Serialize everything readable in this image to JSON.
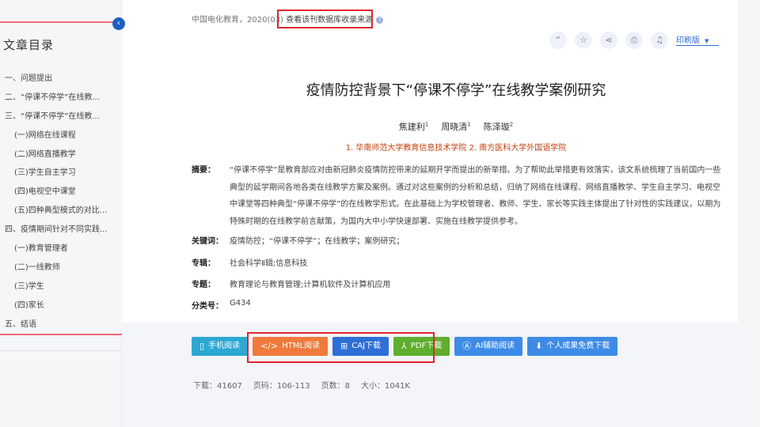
{
  "sidebar": {
    "title": "文章目录",
    "collapse_glyph": "‹",
    "items": [
      {
        "label": "一、问题提出",
        "sub": false
      },
      {
        "label": "二、“停课不停学”在线教...",
        "sub": false
      },
      {
        "label": "三、“停课不停学”在线教...",
        "sub": false
      },
      {
        "label": "(一)网络在线课程",
        "sub": true
      },
      {
        "label": "(二)网络直播教学",
        "sub": true
      },
      {
        "label": "(三)学生自主学习",
        "sub": true
      },
      {
        "label": "(四)电视空中课堂",
        "sub": true
      },
      {
        "label": "(五)四种典型模式的对比...",
        "sub": true
      },
      {
        "label": "四、疫情期间针对不同实践...",
        "sub": false
      },
      {
        "label": "(一)教育管理者",
        "sub": true
      },
      {
        "label": "(二)一线教师",
        "sub": true
      },
      {
        "label": "(三)学生",
        "sub": true
      },
      {
        "label": "(四)家长",
        "sub": true
      },
      {
        "label": "五、结语",
        "sub": false
      }
    ]
  },
  "source": {
    "journal": "中国电化教育，2020(03)",
    "link": "查看该刊数据库收录来源",
    "info_glyph": "?"
  },
  "tools": {
    "icons": [
      {
        "name": "quote-icon",
        "glyph": "“"
      },
      {
        "name": "favorite-icon",
        "glyph": "☆"
      },
      {
        "name": "share-icon",
        "glyph": "⋖"
      },
      {
        "name": "print-icon",
        "glyph": "⎙"
      },
      {
        "name": "bell-icon",
        "glyph": "♫"
      }
    ],
    "print_label": "印刷版",
    "print_arrow": "▼"
  },
  "article": {
    "title": "疫情防控背景下“停课不停学”在线教学案例研究",
    "authors": [
      {
        "name": "焦建利",
        "sup": "1"
      },
      {
        "name": "周晓清",
        "sup": "1"
      },
      {
        "name": "陈泽璇",
        "sup": "2"
      }
    ],
    "affiliations": "1. 华南师范大学教育信息技术学院  2. 南方医科大学外国语学院",
    "abstract_label": "摘要：",
    "abstract": "“停课不停学”是教育部应对由新冠肺炎疫情防控带来的延期开学而提出的新举措。为了帮助此举措更有效落实，该文系统梳理了当前国内一些典型的延学期间各地各类在线教学方案及案例。通过对这些案例的分析和总结，归纳了网络在线课程、网络直播教学、学生自主学习、电视空中课堂等四种典型“停课不停学”的在线教学形式。在此基础上为学校管理者、教师、学生、家长等实践主体提出了针对性的实践建议，以期为特殊时期的在线教学前言献策，为国内大中小学快速部署、实施在线教学提供参考。",
    "keywords_label": "关键词：",
    "keywords": "疫情防控；“停课不停学”；在线教学；案例研究；",
    "series_label": "专辑：",
    "series": "社会科学Ⅱ辑;信息科技",
    "topic_label": "专题：",
    "topic": "教育理论与教育管理;计算机软件及计算机应用",
    "classno_label": "分类号：",
    "classno": "G434"
  },
  "actions": [
    {
      "name": "mobile-read-button",
      "icon_name": "phone-icon",
      "glyph": "▯",
      "label": "手机阅读",
      "cls": "btn-teal"
    },
    {
      "name": "html-read-button",
      "icon_name": "code-icon",
      "glyph": "</>",
      "label": "HTML阅读",
      "cls": "btn-orange"
    },
    {
      "name": "caj-download-button",
      "icon_name": "book-icon",
      "glyph": "⊞",
      "label": "CAJ下载",
      "cls": "btn-blue"
    },
    {
      "name": "pdf-download-button",
      "icon_name": "pdf-icon",
      "glyph": "⅄",
      "label": "PDF下载",
      "cls": "btn-green"
    },
    {
      "name": "ai-read-button",
      "icon_name": "ai-icon",
      "glyph": "Ⓐ",
      "label": "AI辅助阅读",
      "cls": "btn-light"
    },
    {
      "name": "personal-download-button",
      "icon_name": "download-icon",
      "glyph": "⬇",
      "label": "个人成果免费下载",
      "cls": "btn-light"
    }
  ],
  "stats": [
    {
      "label": "下载：",
      "value": "41607"
    },
    {
      "label": "页码：",
      "value": "106-113"
    },
    {
      "label": "页数：",
      "value": "8"
    },
    {
      "label": "大小：",
      "value": "1041K"
    }
  ]
}
